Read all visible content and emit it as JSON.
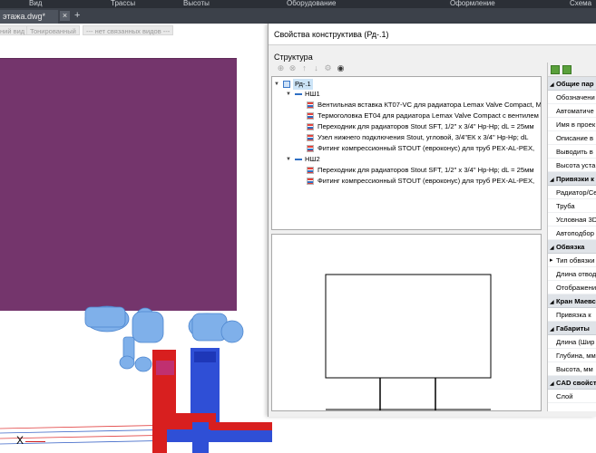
{
  "ribbon": {
    "tabs": [
      "Вид",
      "Трассы",
      "Высоты",
      "Оборудование",
      "Оформление",
      "Схема"
    ]
  },
  "file_tab": {
    "name": "этажа.dwg*",
    "close": "×",
    "new": "+"
  },
  "viewport": {
    "chips": [
      "ний вид",
      "Тонированный",
      "--- нет связанных видов ---"
    ],
    "wall_color": "#74356c",
    "ucs_x_label": "X"
  },
  "dialog": {
    "title": "Свойства конструктива (Рд-.1)",
    "structure_label": "Структура",
    "toolbar_icons": [
      "add-icon",
      "remove-icon",
      "move-up-icon",
      "move-down-icon",
      "tools-icon",
      "eye-icon"
    ],
    "tree": {
      "root": "Рд-.1",
      "groups": [
        {
          "label": "НШ1",
          "items": [
            "Вентильная вставка КТ07-VC для радиатора Lemax Valve Compact, M",
            "Термоголовка ЕТ04 для радиатора Lemax Valve Compact с вентилем",
            "Переходник для радиаторов Stout SFT, 1/2\" x 3/4\" Нр-Нр; dL = 25мм",
            "Узел нижнего подключения Stout, угловой, 3/4\"ЕК х 3/4\" Нр-Нр; dL",
            "Фитинг компрессионный STOUT (евроконус) для труб PEX-AL-PEX,"
          ]
        },
        {
          "label": "НШ2",
          "items": [
            "Переходник для радиаторов Stout SFT, 1/2\" x 3/4\" Нр-Нр; dL = 25мм",
            "Фитинг компрессионный STOUT (евроконус) для труб PEX-AL-PEX,"
          ]
        }
      ]
    },
    "properties": [
      {
        "type": "cat",
        "label": "Общие пар"
      },
      {
        "type": "prop",
        "label": "Обозначени"
      },
      {
        "type": "prop",
        "label": "Автоматиче"
      },
      {
        "type": "prop",
        "label": "Имя в проек"
      },
      {
        "type": "prop",
        "label": "Описание в"
      },
      {
        "type": "prop",
        "label": "Выводить в"
      },
      {
        "type": "prop",
        "label": "Высота уста"
      },
      {
        "type": "cat",
        "label": "Привязки к"
      },
      {
        "type": "prop",
        "label": "Радиатор/Се"
      },
      {
        "type": "prop",
        "label": "Труба"
      },
      {
        "type": "prop",
        "label": "Условная 3D"
      },
      {
        "type": "prop",
        "label": "Автоподбор"
      },
      {
        "type": "cat",
        "label": "Обвязка"
      },
      {
        "type": "arrow",
        "label": "Тип обвязки"
      },
      {
        "type": "prop",
        "label": "Длина отвод"
      },
      {
        "type": "prop",
        "label": "Отображени"
      },
      {
        "type": "cat",
        "label": "Кран Маевс"
      },
      {
        "type": "prop",
        "label": "Привязка к"
      },
      {
        "type": "cat",
        "label": "Габариты"
      },
      {
        "type": "prop",
        "label": "Длина (Шир"
      },
      {
        "type": "prop",
        "label": "Глубина, мм"
      },
      {
        "type": "prop",
        "label": "Высота, мм"
      },
      {
        "type": "cat",
        "label": "CAD свойст"
      },
      {
        "type": "prop",
        "label": "Слой"
      }
    ]
  }
}
